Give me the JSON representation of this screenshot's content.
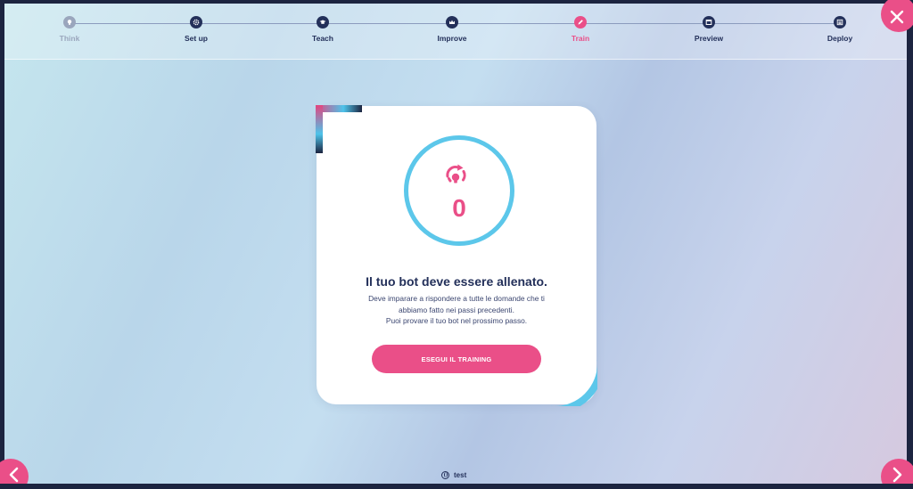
{
  "stepper": {
    "steps": [
      {
        "label": "Think",
        "state": "done",
        "icon": "lightbulb-icon"
      },
      {
        "label": "Set up",
        "state": "todo",
        "icon": "gear-icon"
      },
      {
        "label": "Teach",
        "state": "todo",
        "icon": "graduation-cap-icon"
      },
      {
        "label": "Improve",
        "state": "todo",
        "icon": "crown-icon"
      },
      {
        "label": "Train",
        "state": "active",
        "icon": "pencil-icon"
      },
      {
        "label": "Preview",
        "state": "todo",
        "icon": "window-icon"
      },
      {
        "label": "Deploy",
        "state": "todo",
        "icon": "list-icon"
      }
    ]
  },
  "card": {
    "count": "0",
    "title": "Il tuo bot deve essere allenato.",
    "description": {
      "line1": "Deve imparare a rispondere a tutte le domande che ti",
      "line2": "abbiamo fatto nei passi precedenti.",
      "line3": "Puoi provare il tuo bot nel prossimo passo."
    },
    "button_label": "ESEGUI IL TRAINING"
  },
  "footer": {
    "bot_name": "test"
  },
  "colors": {
    "accent": "#ea4f88",
    "primary": "#23305a",
    "ring": "#5cc7ea",
    "muted": "#9aa6bd"
  }
}
